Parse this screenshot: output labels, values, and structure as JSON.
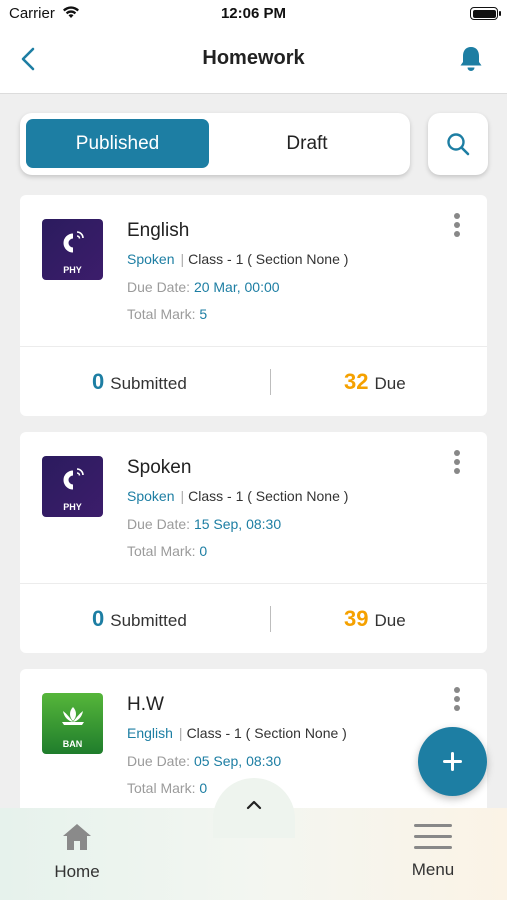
{
  "status_bar": {
    "carrier": "Carrier",
    "time": "12:06 PM"
  },
  "nav": {
    "title": "Homework"
  },
  "segments": {
    "published": "Published",
    "draft": "Draft",
    "selected": "Published"
  },
  "cards": [
    {
      "icon_code": "PHY",
      "title": "English",
      "subject": "Spoken",
      "class_info": "Class - 1 ( Section None )",
      "due_label": "Due Date:",
      "due_value": "20 Mar, 00:00",
      "mark_label": "Total Mark:",
      "mark_value": "5",
      "submitted_count": "0",
      "submitted_label": "Submitted",
      "due_count": "32",
      "due_count_label": "Due"
    },
    {
      "icon_code": "PHY",
      "title": "Spoken",
      "subject": "Spoken",
      "class_info": "Class - 1 ( Section None )",
      "due_label": "Due Date:",
      "due_value": "15 Sep, 08:30",
      "mark_label": "Total Mark:",
      "mark_value": "0",
      "submitted_count": "0",
      "submitted_label": "Submitted",
      "due_count": "39",
      "due_count_label": "Due"
    },
    {
      "icon_code": "BAN",
      "title": "H.W",
      "subject": "English",
      "class_info": "Class - 1 ( Section None )",
      "due_label": "Due Date:",
      "due_value": "05 Sep, 08:30",
      "mark_label": "Total Mark:",
      "mark_value": "0"
    }
  ],
  "bottom_nav": {
    "home": "Home",
    "menu": "Menu"
  },
  "colors": {
    "accent": "#1d7ea3",
    "due": "#f5a100"
  }
}
